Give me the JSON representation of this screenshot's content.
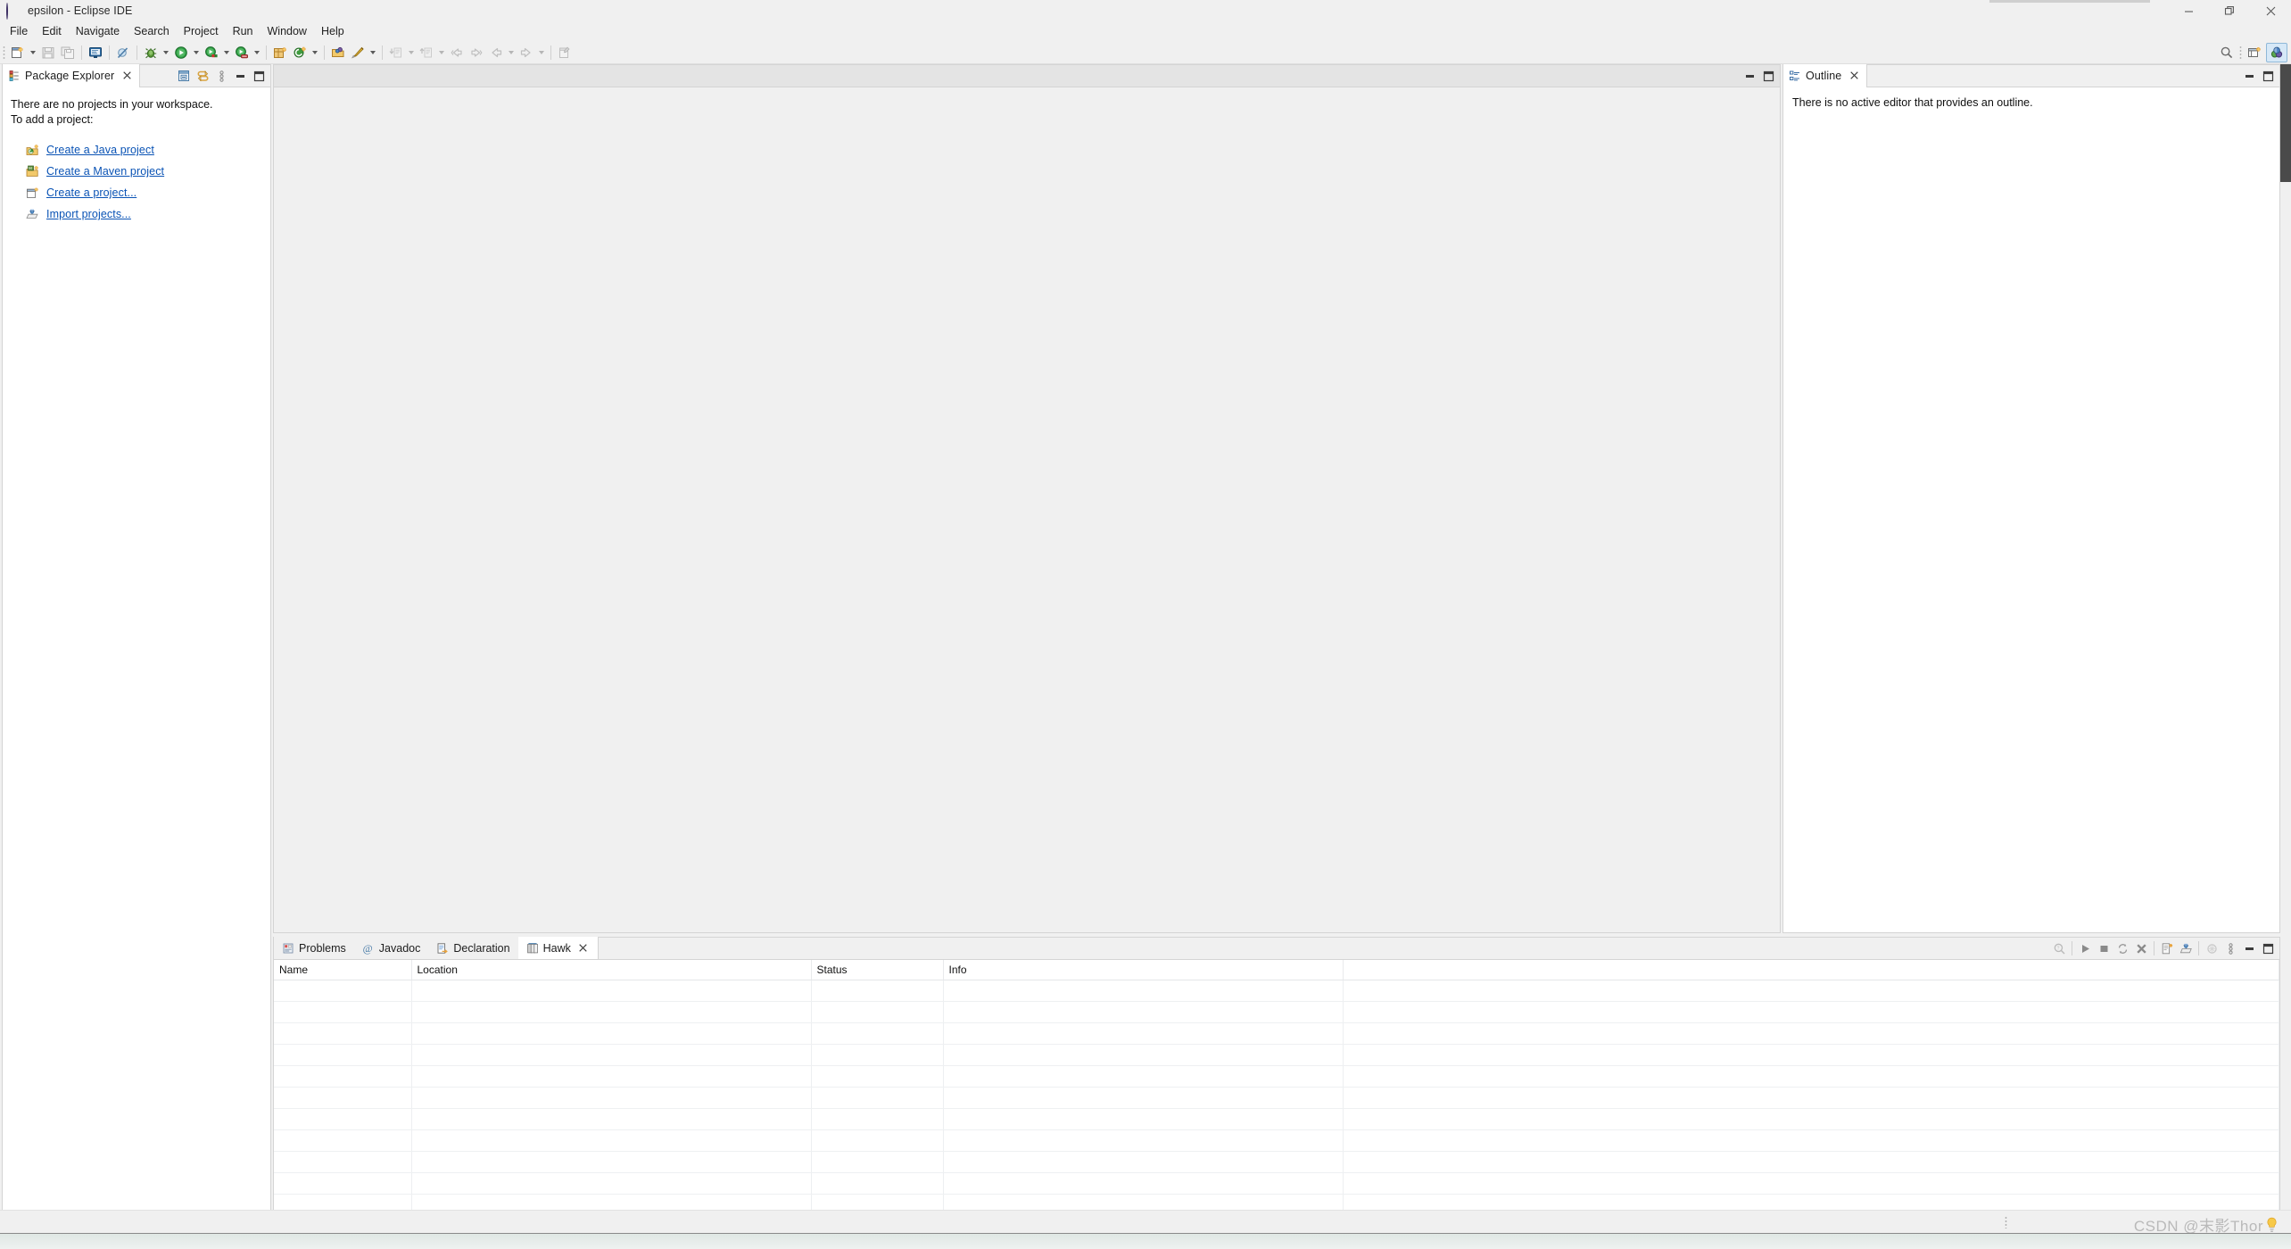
{
  "window": {
    "title": "epsilon - Eclipse IDE",
    "app_icon": "eclipse-logo-icon",
    "controls": [
      {
        "name": "minimize-button",
        "glyph": "minimize-icon"
      },
      {
        "name": "restore-button",
        "glyph": "restore-icon"
      },
      {
        "name": "close-button",
        "glyph": "close-icon"
      }
    ]
  },
  "menubar": {
    "items": [
      {
        "label": "File"
      },
      {
        "label": "Edit"
      },
      {
        "label": "Navigate"
      },
      {
        "label": "Search"
      },
      {
        "label": "Project"
      },
      {
        "label": "Run"
      },
      {
        "label": "Window"
      },
      {
        "label": "Help"
      }
    ]
  },
  "toolbar": {
    "groups": [
      {
        "items": [
          {
            "name": "new-wizard-button",
            "icon": "new-file-icon",
            "enabled": true,
            "dropdown": true
          },
          {
            "name": "save-button",
            "icon": "save-icon",
            "enabled": false
          },
          {
            "name": "save-all-button",
            "icon": "save-all-icon",
            "enabled": false
          }
        ]
      },
      {
        "items": [
          {
            "name": "new-java-console-button",
            "icon": "console-icon",
            "enabled": true
          }
        ]
      },
      {
        "items": [
          {
            "name": "skip-breakpoints-button",
            "icon": "skip-breakpoints-icon",
            "enabled": true
          }
        ]
      },
      {
        "items": [
          {
            "name": "debug-button",
            "icon": "debug-bug-icon",
            "enabled": true,
            "dropdown": true
          },
          {
            "name": "run-button",
            "icon": "run-play-icon",
            "enabled": true,
            "dropdown": true
          },
          {
            "name": "coverage-button",
            "icon": "coverage-icon",
            "enabled": true,
            "dropdown": true
          },
          {
            "name": "run-external-tools-button",
            "icon": "external-tools-icon",
            "enabled": true,
            "dropdown": true
          }
        ]
      },
      {
        "items": [
          {
            "name": "new-package-button",
            "icon": "new-package-icon",
            "enabled": true
          },
          {
            "name": "new-class-button",
            "icon": "new-class-icon",
            "enabled": true,
            "dropdown": true
          }
        ]
      },
      {
        "items": [
          {
            "name": "open-type-button",
            "icon": "open-type-icon",
            "enabled": true
          },
          {
            "name": "open-task-button",
            "icon": "open-task-icon",
            "enabled": true,
            "dropdown": true
          }
        ]
      },
      {
        "items": [
          {
            "name": "previous-annotation-button",
            "icon": "prev-annotation-icon",
            "enabled": false,
            "dropdown": true
          },
          {
            "name": "next-annotation-button",
            "icon": "next-annotation-icon",
            "enabled": false,
            "dropdown": true
          },
          {
            "name": "back-history-button",
            "icon": "back-arrow-icon",
            "enabled": false
          },
          {
            "name": "forward-history-button",
            "icon": "forward-arrow-icon",
            "enabled": false
          },
          {
            "name": "previous-edit-button",
            "icon": "prev-edit-arrow-icon",
            "enabled": false,
            "dropdown": true
          },
          {
            "name": "next-edit-button",
            "icon": "next-edit-arrow-icon",
            "enabled": false,
            "dropdown": true
          }
        ]
      },
      {
        "items": [
          {
            "name": "new-untitled-text-file-button",
            "icon": "new-text-file-icon",
            "enabled": false
          }
        ]
      }
    ],
    "right_items": [
      {
        "name": "quick-access-search-button",
        "icon": "search-icon"
      },
      {
        "name": "open-perspective-button",
        "icon": "open-perspective-icon"
      },
      {
        "name": "java-perspective-button",
        "icon": "java-perspective-icon",
        "active": true
      }
    ]
  },
  "package_explorer": {
    "tab": {
      "label": "Package Explorer",
      "icon": "package-explorer-icon",
      "closable": true
    },
    "view_tools": [
      {
        "name": "collapse-all-button",
        "icon": "collapse-all-icon"
      },
      {
        "name": "link-with-editor-button",
        "icon": "link-editor-icon"
      },
      {
        "name": "view-menu-button",
        "icon": "view-menu-icon"
      },
      {
        "name": "minimize-view-button",
        "icon": "minimize-icon"
      },
      {
        "name": "maximize-view-button",
        "icon": "maximize-icon"
      }
    ],
    "empty_message_line1": "There are no projects in your workspace.",
    "empty_message_line2": "To add a project:",
    "links": [
      {
        "label": "Create a Java project",
        "icon": "new-java-project-icon"
      },
      {
        "label": "Create a Maven project",
        "icon": "new-maven-project-icon"
      },
      {
        "label": "Create a project...",
        "icon": "new-project-icon"
      },
      {
        "label": "Import projects...",
        "icon": "import-projects-icon"
      }
    ]
  },
  "editor_area": {
    "view_tools": [
      {
        "name": "minimize-editor-button",
        "icon": "minimize-icon"
      },
      {
        "name": "maximize-editor-button",
        "icon": "maximize-icon"
      }
    ]
  },
  "outline": {
    "tab": {
      "label": "Outline",
      "icon": "outline-icon",
      "closable": true
    },
    "view_tools": [
      {
        "name": "minimize-view-button",
        "icon": "minimize-icon"
      },
      {
        "name": "maximize-view-button",
        "icon": "maximize-icon"
      }
    ],
    "empty_message": "There is no active editor that provides an outline."
  },
  "bottom_panel": {
    "tabs": [
      {
        "label": "Problems",
        "icon": "problems-icon",
        "active": false,
        "closable": false
      },
      {
        "label": "Javadoc",
        "icon": "javadoc-icon",
        "active": false,
        "closable": false
      },
      {
        "label": "Declaration",
        "icon": "declaration-icon",
        "active": false,
        "closable": false
      },
      {
        "label": "Hawk",
        "icon": "hawk-icon",
        "active": true,
        "closable": true
      }
    ],
    "view_tools": [
      {
        "name": "query-button",
        "icon": "query-search-icon",
        "enabled": false
      },
      {
        "name": "run-index-button",
        "icon": "run-play-icon",
        "enabled": true
      },
      {
        "name": "stop-index-button",
        "icon": "stop-square-icon",
        "enabled": true
      },
      {
        "name": "sync-button",
        "icon": "sync-icon",
        "enabled": true
      },
      {
        "name": "delete-button",
        "icon": "delete-x-icon",
        "enabled": true
      },
      {
        "name": "new-instance-button",
        "icon": "new-instance-icon",
        "enabled": true
      },
      {
        "name": "import-instance-button",
        "icon": "import-instance-icon",
        "enabled": true
      },
      {
        "name": "configure-button",
        "icon": "configure-icon",
        "enabled": false
      },
      {
        "name": "view-menu-button",
        "icon": "view-menu-icon",
        "enabled": true
      },
      {
        "name": "minimize-view-button",
        "icon": "minimize-icon",
        "enabled": true
      },
      {
        "name": "maximize-view-button",
        "icon": "maximize-icon",
        "enabled": true
      }
    ],
    "table": {
      "columns": [
        "Name",
        "Location",
        "Status",
        "Info"
      ],
      "rows": [],
      "empty_row_count": 11
    }
  },
  "statusbar": {
    "watermark_text": "CSDN @末影Thor",
    "watermark_icon": "lightbulb-icon"
  }
}
